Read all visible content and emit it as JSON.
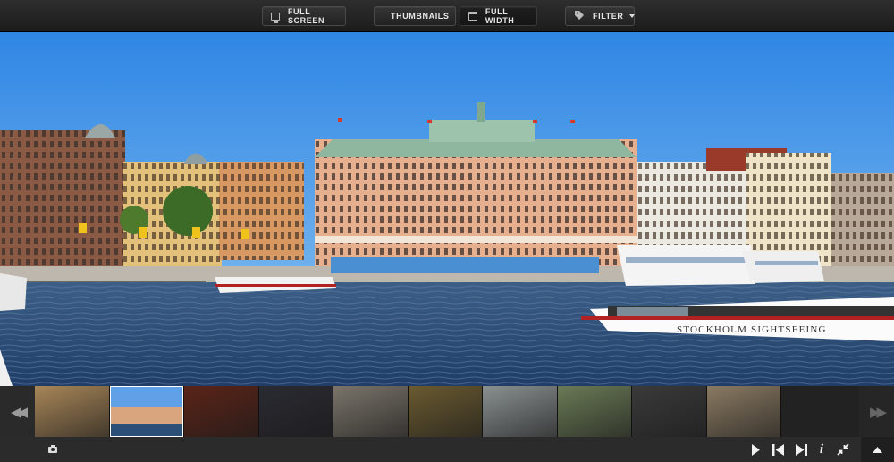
{
  "toolbar": {
    "full_screen_label": "FULL SCREEN",
    "thumbnails_label": "THUMBNAILS",
    "full_width_label": "FULL WIDTH",
    "filter_label": "FILTER"
  },
  "main_image": {
    "boat_text": "STOCKHOLM SIGHTSEEING"
  },
  "icons": {
    "full_screen": "monitor-icon",
    "thumbnails": "grid-icon",
    "full_width": "window-icon",
    "filter": "tag-icon",
    "left_nav": "double-chevron-left-icon",
    "right_nav": "double-chevron-right-icon",
    "camera": "camera-icon",
    "play": "play-icon",
    "prev": "skip-previous-icon",
    "next": "skip-next-icon",
    "info": "info-icon",
    "shrink": "collapse-icon",
    "up": "chevron-up-icon"
  },
  "thumbnails": [
    {
      "name": "desert-tree",
      "color": "#a88658"
    },
    {
      "name": "stockholm",
      "color": "#6a8fb5",
      "selected": true
    },
    {
      "name": "violin",
      "color": "#5a2418"
    },
    {
      "name": "vinyl-record",
      "color": "#2a2a32"
    },
    {
      "name": "sheet-music",
      "color": "#7a746a"
    },
    {
      "name": "sunset-water",
      "color": "#6a5a30"
    },
    {
      "name": "city-monument",
      "color": "#8a9090"
    },
    {
      "name": "machu-picchu",
      "color": "#6a7a55"
    },
    {
      "name": "piano-keys",
      "color": "#3a3a3a"
    },
    {
      "name": "pen-paper",
      "color": "#8a7a62"
    }
  ],
  "colors": {
    "sky": "#3e8ee0",
    "water": "#2c4f78",
    "bar": "#2b2b2b"
  }
}
